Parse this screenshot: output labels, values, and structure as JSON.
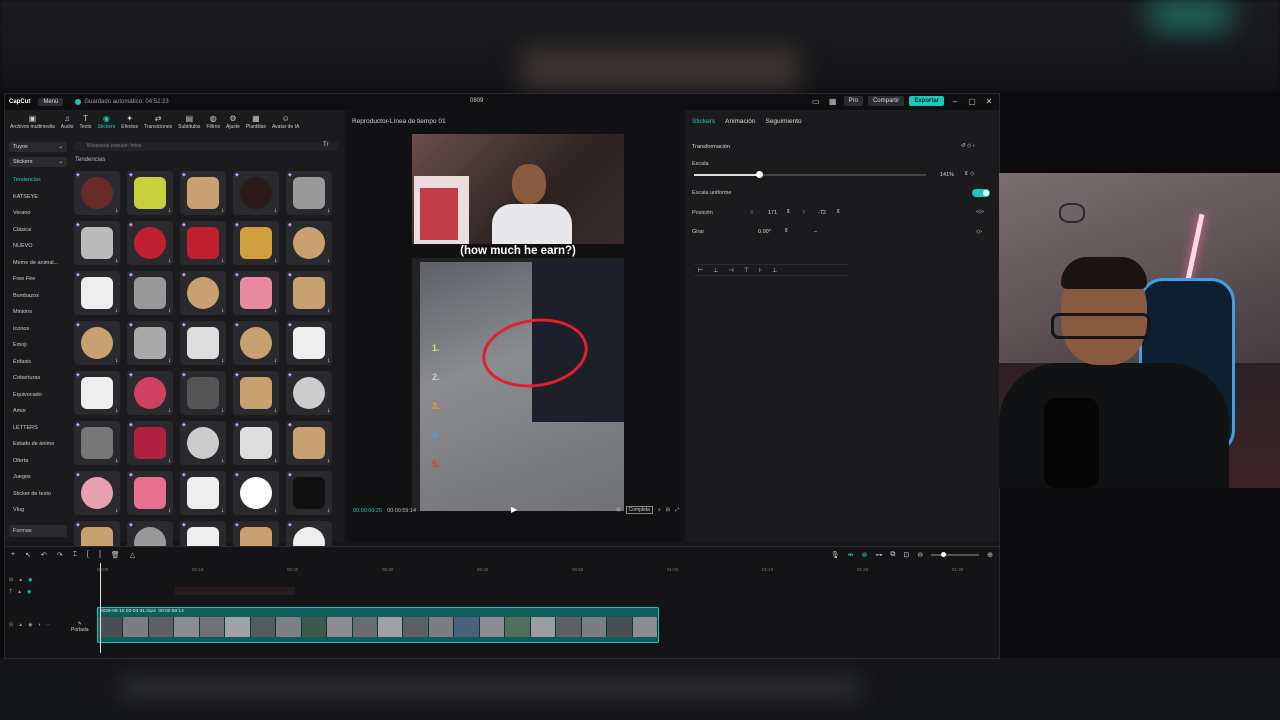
{
  "app": {
    "logo": "CapCut",
    "menu_label": "Menú",
    "autosave": "Guardado automático: 04:52:23",
    "project_name": "0809",
    "pro_label": "Pro",
    "share_label": "Compartir",
    "export_label": "Exportar"
  },
  "toolbar": {
    "items": [
      "Archivos multimedia",
      "Audio",
      "Texto",
      "Stickers",
      "Efectos",
      "Transiciones",
      "Subtítulos",
      "Filtros",
      "Ajuste",
      "Plantillas",
      "Avatar de IA"
    ],
    "icons": [
      "▣",
      "♫",
      "T",
      "◉",
      "✦",
      "⇄",
      "▤",
      "◍",
      "⚙",
      "▦",
      "☺"
    ]
  },
  "left_panel": {
    "category_select": "Tuyos",
    "category_select2": "Stickers",
    "categories": [
      "Tendencias",
      "KATSEYE",
      "Verano",
      "Clásica",
      "NUEVO",
      "Meme de animal...",
      "Free Fire",
      "Bombazos",
      "Minions",
      "Iconos",
      "Emoji",
      "Énfasis",
      "Coberturas",
      "Equivocado",
      "Amor",
      "LETTERS",
      "Estado de ánimo",
      "Oferta",
      "Juegos",
      "Sticker de texto",
      "Vlog",
      "Formas"
    ],
    "search_placeholder": "Búsqueda popular: fotos",
    "section_title": "Tendencias",
    "text_tool": "Tr",
    "sticker_colors": [
      "#6b2a2a",
      "#c8d03a",
      "#c9a070",
      "#2a1a1a",
      "#999",
      "#bbb",
      "#c02030",
      "#c02030",
      "#d0a040",
      "#c9a070",
      "#eee",
      "#999",
      "#c9a070",
      "#e88aa0",
      "#c9a070",
      "#c9a070",
      "#aaa",
      "#ddd",
      "#c9a070",
      "#eee",
      "#eee",
      "#d04060",
      "#555",
      "#c9a070",
      "#ccc",
      "#777",
      "#b02040",
      "#ccc",
      "#ddd",
      "#c9a070",
      "#e8a0b0",
      "#e87090",
      "#eee",
      "#fff",
      "#111",
      "#c9a070",
      "#999",
      "#eee",
      "#c9a070",
      "#eee"
    ]
  },
  "preview": {
    "title": "Reproductor-Línea de tiempo 01",
    "caption": "(how much he earn?)",
    "numbers": [
      "1.",
      "2.",
      "3.",
      "4.",
      "5."
    ],
    "number_colors": [
      "#d7e83a",
      "#cfcfcf",
      "#ff9a1a",
      "#3aa0ff",
      "#ff2a2a"
    ],
    "current_time": "00:00:00:20",
    "total_time": "00:00:59:14",
    "ratio_label": "Completa"
  },
  "inspector": {
    "tabs": [
      "Stickers",
      "Animación",
      "Seguimiento"
    ],
    "transform_label": "Transformación",
    "scale_label": "Escala",
    "scale_value": "141%",
    "scale_fraction": 0.28,
    "uniform_label": "Escala uniforme",
    "position_label": "Posición",
    "pos_x_label": "X",
    "pos_x": "171",
    "pos_y_label": "Y",
    "pos_y": "-72",
    "rotate_label": "Girar",
    "rotate_value": "0.00°",
    "rotate_extra": "–"
  },
  "timeline": {
    "ruler": [
      "00:00",
      "00:10",
      "00:20",
      "00:30",
      "00:40",
      "00:50",
      "01:00",
      "01:10",
      "01:20",
      "01:30"
    ],
    "clip_name": "2026-08-15 03-04-31.mp4",
    "clip_duration": "00:00:59:14",
    "cover_label": "Portada",
    "thumb_colors": [
      "#4a4f55",
      "#7a7e82",
      "#5d6166",
      "#8a8c8f",
      "#6f7174",
      "#a0a2a5",
      "#555a5f",
      "#7b8085",
      "#3d5a4a",
      "#8a8c8f",
      "#6a6d70",
      "#9fa2a5",
      "#5c6064",
      "#7a7e82",
      "#48627a",
      "#8a8c8f",
      "#4f6f5a",
      "#9a9ca0",
      "#5d6166",
      "#7a7e82",
      "#4a4f55",
      "#8a8c8f"
    ]
  }
}
